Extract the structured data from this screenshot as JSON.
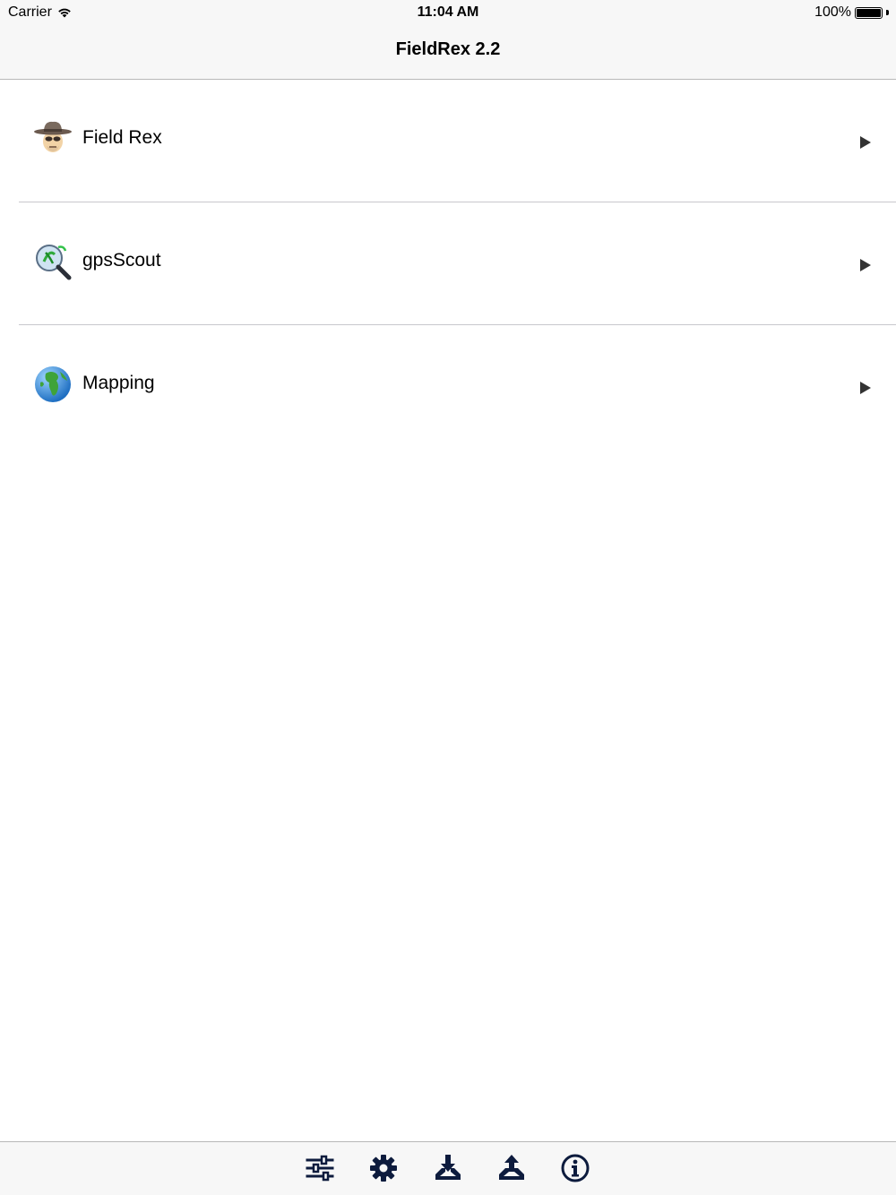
{
  "status": {
    "carrier": "Carrier",
    "time": "11:04 AM",
    "battery": "100%"
  },
  "nav": {
    "title": "FieldRex 2.2"
  },
  "menu": {
    "items": [
      {
        "label": "Field Rex",
        "icon": "cowboy-icon"
      },
      {
        "label": "gpsScout",
        "icon": "magnifier-plant-icon"
      },
      {
        "label": "Mapping",
        "icon": "globe-icon"
      }
    ]
  },
  "toolbar": {
    "icons": [
      "sliders-icon",
      "gear-icon",
      "download-icon",
      "upload-icon",
      "info-icon"
    ],
    "icon_color": "#0d1b3d"
  }
}
